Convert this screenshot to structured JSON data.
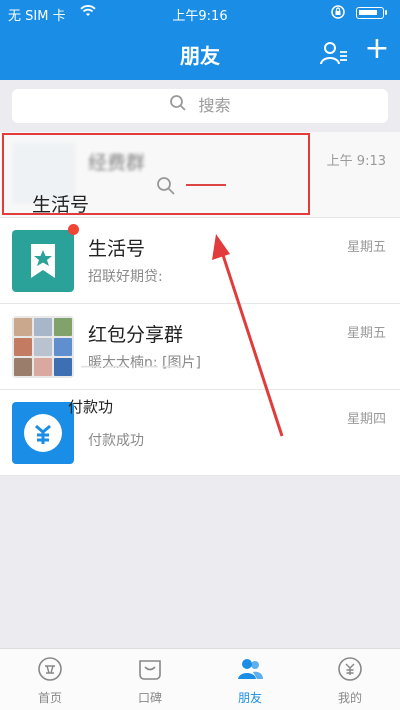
{
  "status": {
    "carrier": "无 SIM 卡",
    "time": "上午9:16"
  },
  "nav": {
    "title": "朋友",
    "add_friend_icon": "add-contact-icon",
    "plus_label": "+"
  },
  "search": {
    "placeholder": "搜索"
  },
  "overlay": {
    "highlighted_label": "生活号"
  },
  "conversations": [
    {
      "name": "经费群",
      "preview": "",
      "time": "上午 9:13"
    },
    {
      "name": "生活号",
      "preview": "招联好期贷:",
      "time": "星期五"
    },
    {
      "name": "红包分享群",
      "preview": "暖大大楠n: [图片]",
      "time": "星期五"
    },
    {
      "name": "付款成功",
      "preview": "付款成功",
      "overlay_label": "付款功",
      "time": "星期四"
    }
  ],
  "tabs": [
    {
      "label": "首页",
      "icon": "home-icon"
    },
    {
      "label": "口碑",
      "icon": "koubei-icon"
    },
    {
      "label": "朋友",
      "icon": "friends-icon",
      "active": true
    },
    {
      "label": "我的",
      "icon": "my-wallet-icon"
    }
  ],
  "colors": {
    "primary": "#1a8ee7",
    "highlight_box": "#e23b3b",
    "badge": "#f04434",
    "life_avatar": "#2aa29a"
  }
}
